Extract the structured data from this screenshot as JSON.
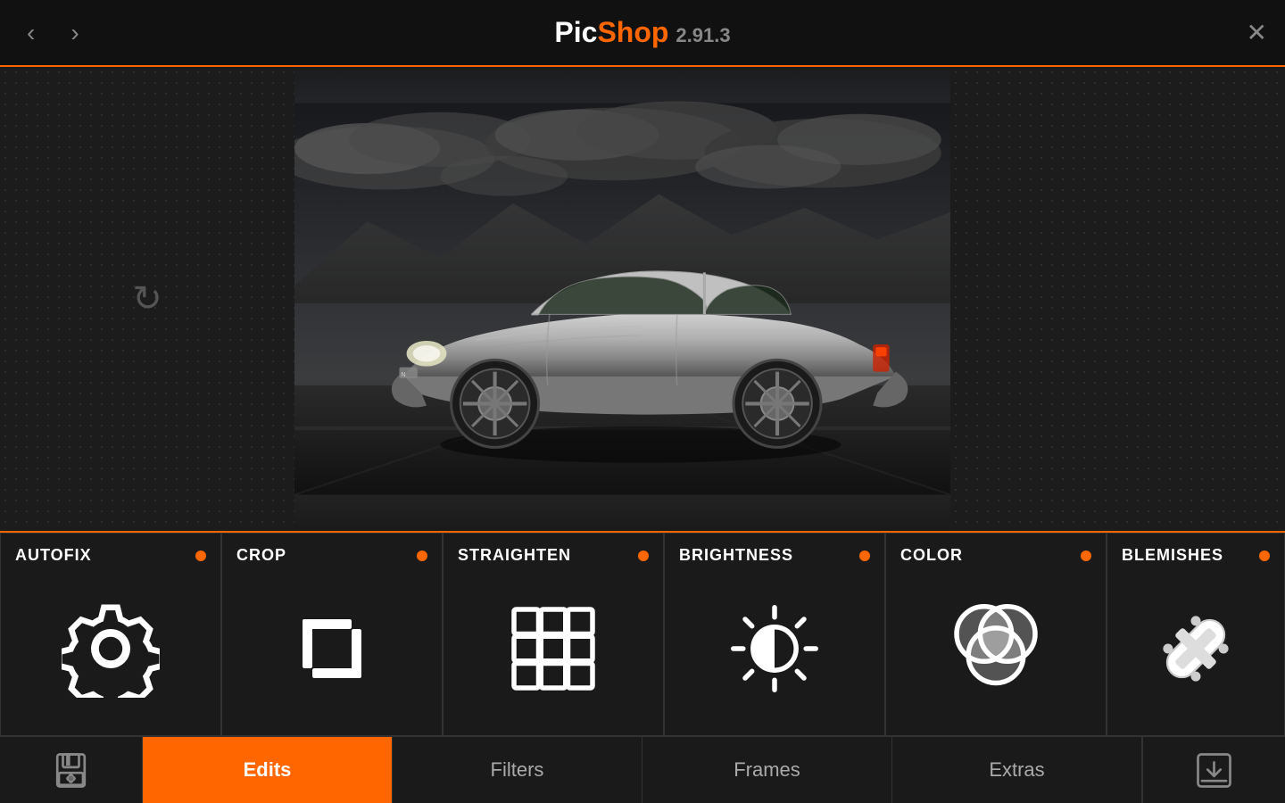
{
  "app": {
    "title_pic": "Pic",
    "title_shop": "Shop",
    "version": "2.91.3"
  },
  "header": {
    "back_label": "‹",
    "forward_label": "›",
    "close_label": "✕",
    "refresh_label": "↻"
  },
  "tools": [
    {
      "id": "autofix",
      "label": "AUTOFIX",
      "icon": "gear"
    },
    {
      "id": "crop",
      "label": "CROP",
      "icon": "crop"
    },
    {
      "id": "straighten",
      "label": "STRAIGHTEN",
      "icon": "grid"
    },
    {
      "id": "brightness",
      "label": "BRIGHTNESS",
      "icon": "brightness"
    },
    {
      "id": "color",
      "label": "COLOR",
      "icon": "color"
    },
    {
      "id": "blemishes",
      "label": "BLEMISHES",
      "icon": "blemishes"
    }
  ],
  "tabs": [
    {
      "id": "save",
      "label": "",
      "icon": "save"
    },
    {
      "id": "edits",
      "label": "Edits",
      "active": true
    },
    {
      "id": "filters",
      "label": "Filters",
      "active": false
    },
    {
      "id": "frames",
      "label": "Frames",
      "active": false
    },
    {
      "id": "extras",
      "label": "Extras",
      "active": false
    },
    {
      "id": "export",
      "label": "",
      "icon": "export"
    }
  ],
  "colors": {
    "accent": "#ff6600",
    "bg_dark": "#111111",
    "bg_medium": "#1a1a1a",
    "text_primary": "#ffffff",
    "text_secondary": "#888888"
  }
}
